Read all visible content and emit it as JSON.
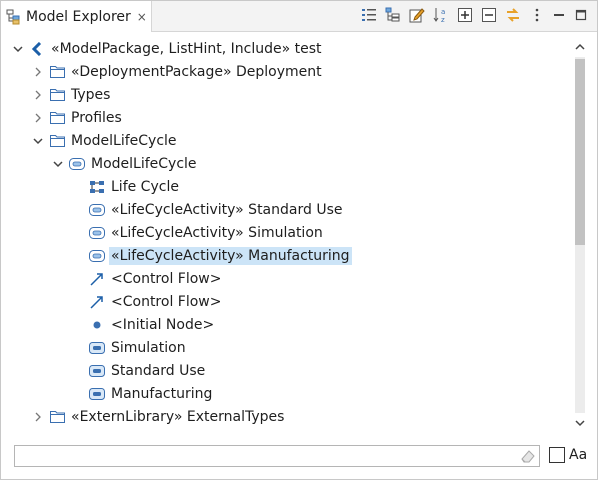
{
  "tab": {
    "title": "Model Explorer",
    "close_glyph": "×"
  },
  "toolbar": {
    "buttons": [
      "filter-list-icon",
      "tree-layout-icon",
      "edit-icon",
      "sort-az-icon",
      "expand-all-icon",
      "collapse-all-icon",
      "link-with-editor-icon",
      "view-menu-icon"
    ],
    "win": [
      "minimize-icon",
      "maximize-icon"
    ]
  },
  "tree": {
    "items": [
      {
        "label": "«ModelPackage, ListHint, Include» test",
        "level": 0,
        "expanded": true,
        "icon": "model-package-icon",
        "has_children": true
      },
      {
        "label": "«DeploymentPackage» Deployment",
        "level": 1,
        "expanded": false,
        "icon": "folder-icon",
        "has_children": true
      },
      {
        "label": "Types",
        "level": 1,
        "expanded": false,
        "icon": "folder-icon",
        "has_children": true
      },
      {
        "label": "Profiles",
        "level": 1,
        "expanded": false,
        "icon": "folder-icon",
        "has_children": true
      },
      {
        "label": "ModelLifeCycle",
        "level": 1,
        "expanded": true,
        "icon": "folder-icon",
        "has_children": true
      },
      {
        "label": "ModelLifeCycle",
        "level": 2,
        "expanded": true,
        "icon": "activity-icon",
        "has_children": true
      },
      {
        "label": "Life Cycle",
        "level": 3,
        "icon": "diagram-icon",
        "has_children": false
      },
      {
        "label": "«LifeCycleActivity» Standard Use",
        "level": 3,
        "icon": "activity-icon",
        "has_children": false
      },
      {
        "label": "«LifeCycleActivity» Simulation",
        "level": 3,
        "icon": "activity-icon",
        "has_children": false
      },
      {
        "label": "«LifeCycleActivity» Manufacturing",
        "level": 3,
        "icon": "activity-icon",
        "has_children": false,
        "selected": true
      },
      {
        "label": "<Control Flow>",
        "level": 3,
        "icon": "control-flow-icon",
        "has_children": false
      },
      {
        "label": "<Control Flow>",
        "level": 3,
        "icon": "control-flow-icon",
        "has_children": false
      },
      {
        "label": "<Initial Node>",
        "level": 3,
        "icon": "initial-node-icon",
        "has_children": false
      },
      {
        "label": "Simulation",
        "level": 3,
        "icon": "action-icon",
        "has_children": false
      },
      {
        "label": "Standard Use",
        "level": 3,
        "icon": "action-icon",
        "has_children": false
      },
      {
        "label": "Manufacturing",
        "level": 3,
        "icon": "action-icon",
        "has_children": false
      },
      {
        "label": "«ExternLibrary» ExternalTypes",
        "level": 1,
        "expanded": false,
        "icon": "folder-icon",
        "has_children": true
      }
    ]
  },
  "filter": {
    "value": "",
    "placeholder": "",
    "match_case_label": "Aa",
    "match_case_checked": false
  },
  "colors": {
    "selection": "#cce4f7",
    "folder": "#3a6fb0",
    "accent": "#1c5fa8"
  }
}
